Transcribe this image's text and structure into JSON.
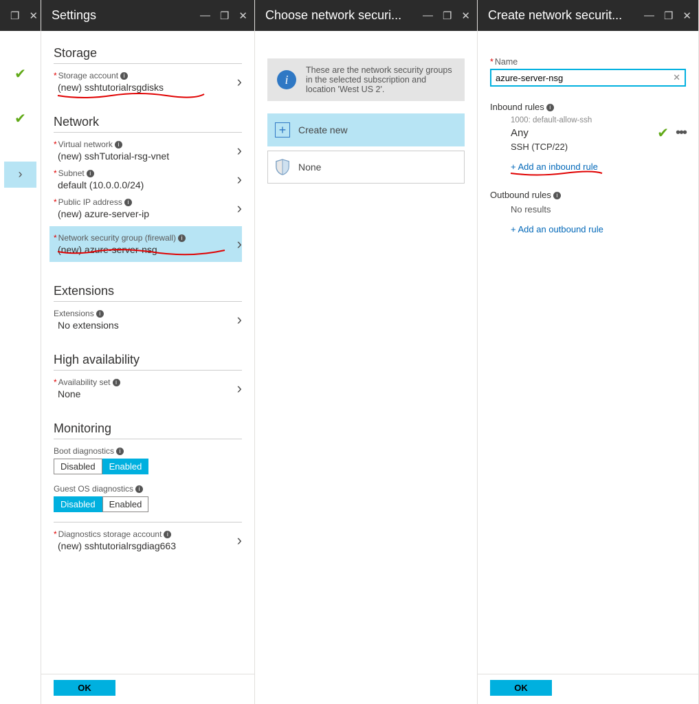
{
  "blade0": {},
  "blade1": {
    "title": "Settings",
    "sections": {
      "storage": {
        "heading": "Storage",
        "account_label": "Storage account",
        "account_value": "(new) sshtutorialrsgdisks"
      },
      "network": {
        "heading": "Network",
        "vnet_label": "Virtual network",
        "vnet_value": "(new) sshTutorial-rsg-vnet",
        "subnet_label": "Subnet",
        "subnet_value": "default (10.0.0.0/24)",
        "pip_label": "Public IP address",
        "pip_value": "(new) azure-server-ip",
        "nsg_label": "Network security group (firewall)",
        "nsg_value": "(new) azure-server-nsg"
      },
      "extensions": {
        "heading": "Extensions",
        "ext_label": "Extensions",
        "ext_value": "No extensions"
      },
      "ha": {
        "heading": "High availability",
        "avail_label": "Availability set",
        "avail_value": "None"
      },
      "monitoring": {
        "heading": "Monitoring",
        "boot_label": "Boot diagnostics",
        "disabled": "Disabled",
        "enabled": "Enabled",
        "guest_label": "Guest OS diagnostics",
        "diag_label": "Diagnostics storage account",
        "diag_value": "(new) sshtutorialrsgdiag663"
      }
    },
    "ok": "OK"
  },
  "blade2": {
    "title": "Choose network securi...",
    "info_text": "These are the network security groups in the selected subscription and location 'West US 2'.",
    "create_new": "Create new",
    "none": "None"
  },
  "blade3": {
    "title": "Create network securit...",
    "name_label": "Name",
    "name_value": "azure-server-nsg",
    "inbound_heading": "Inbound rules",
    "rule_meta": "1000: default-allow-ssh",
    "rule_any": "Any",
    "rule_detail": "SSH (TCP/22)",
    "add_inbound": "+ Add an inbound rule",
    "outbound_heading": "Outbound rules",
    "no_results": "No results",
    "add_outbound": "+ Add an outbound rule",
    "ok": "OK"
  }
}
